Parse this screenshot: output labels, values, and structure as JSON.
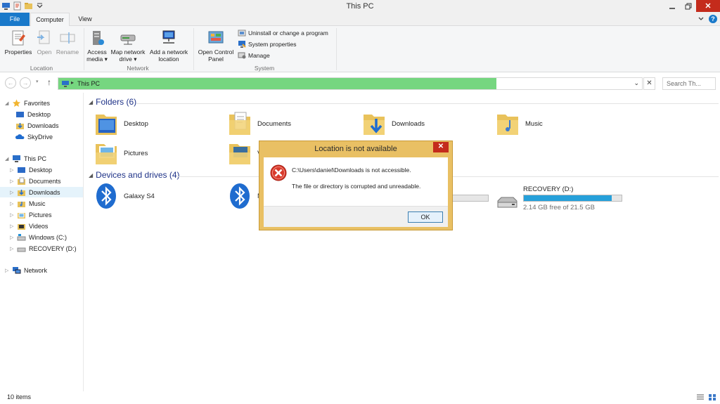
{
  "window": {
    "title": "This PC"
  },
  "tabs": {
    "file": "File",
    "computer": "Computer",
    "view": "View"
  },
  "ribbon": {
    "location": {
      "label": "Location",
      "properties": "Properties",
      "open": "Open",
      "rename": "Rename"
    },
    "network": {
      "label": "Network",
      "access_media": [
        "Access",
        "media ▾"
      ],
      "map_network_drive": [
        "Map network",
        "drive ▾"
      ],
      "add_network_location": [
        "Add a network",
        "location"
      ]
    },
    "system": {
      "label": "System",
      "open_control_panel": [
        "Open Control",
        "Panel"
      ],
      "uninstall": "Uninstall or change a program",
      "system_properties": "System properties",
      "manage": "Manage"
    }
  },
  "address": {
    "crumb": "This PC",
    "search_placeholder": "Search Th...",
    "load_progress": 0.75
  },
  "nav": {
    "favorites": "Favorites",
    "fav_items": [
      "Desktop",
      "Downloads",
      "SkyDrive"
    ],
    "this_pc": "This PC",
    "pc_items": [
      "Desktop",
      "Documents",
      "Downloads",
      "Music",
      "Pictures",
      "Videos",
      "Windows (C:)",
      "RECOVERY (D:)"
    ],
    "network": "Network"
  },
  "content": {
    "folders_header": "Folders (6)",
    "folders": [
      "Desktop",
      "Documents",
      "Downloads",
      "Music",
      "Pictures",
      "V"
    ],
    "devices_header": "Devices and drives (4)",
    "devices": [
      "Galaxy S4",
      "N"
    ],
    "recovery": {
      "name": "RECOVERY (D:)",
      "free": "2.14 GB free of 21.5 GB",
      "used_fraction": 0.9
    }
  },
  "status": {
    "items": "10 items"
  },
  "dialog": {
    "title": "Location is not available",
    "line1": "C:\\Users\\daniel\\Downloads is not accessible.",
    "line2": "The file or directory is corrupted and unreadable.",
    "ok": "OK"
  },
  "colors": {
    "accent": "#1979ca",
    "address_fill": "#76d680",
    "dialog_frame": "#e9c064",
    "close": "#c42b1c"
  }
}
